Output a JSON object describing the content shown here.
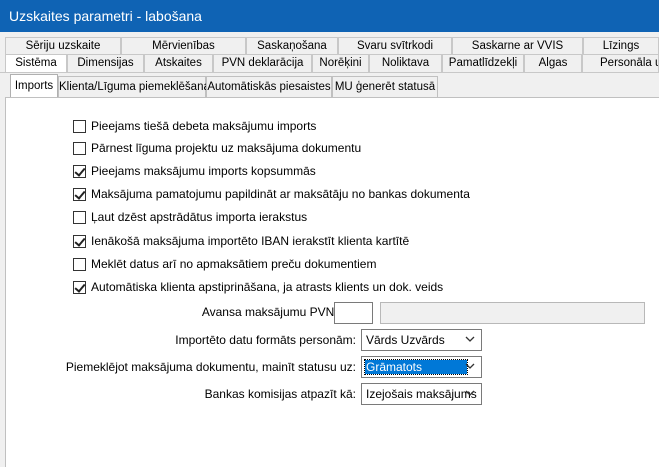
{
  "window": {
    "title": "Uzskaites parametri - labošana"
  },
  "tabs_row1": [
    "Sēriju uzskaite",
    "Mērvienības",
    "Saskaņošana",
    "Svaru svītrkodi",
    "Saskarne ar VVIS",
    "Līzings"
  ],
  "tabs_row2": [
    "Sistēma",
    "Dimensijas",
    "Atskaites",
    "PVN deklarācija",
    "Norēķini",
    "Noliktava",
    "Pamatlīdzekļi",
    "Algas",
    "Personāla uz"
  ],
  "active_tab_row2": "Sistēma",
  "subtabs": [
    "Imports",
    "Klienta/Līguma piemeklēšana",
    "Automātiskās piesaistes",
    "MU ģenerēt statusā"
  ],
  "active_subtab": "Imports",
  "checkboxes": [
    {
      "label": "Pieejams tiešā debeta maksājumu imports",
      "checked": false
    },
    {
      "label": "Pārnest līguma projektu uz maksājuma dokumentu",
      "checked": false
    },
    {
      "label": "Pieejams maksājumu imports kopsummās",
      "checked": true
    },
    {
      "label": "Maksājuma pamatojumu papildināt ar maksātāju no bankas dokumenta",
      "checked": true
    },
    {
      "label": "Ļaut dzēst apstrādātus importa ierakstus",
      "checked": false
    },
    {
      "label": "Ienākošā maksājuma importēto IBAN ierakstīt klienta kartītē",
      "checked": true
    },
    {
      "label": "Meklēt datus arī no apmaksātiem preču dokumentiem",
      "checked": false
    },
    {
      "label": "Automātiska klienta apstiprināšana, ja atrasts klients un dok. veids",
      "checked": true
    }
  ],
  "fields": {
    "avansa_label": "Avansa maksājumu PVN likme:",
    "avansa_value": "",
    "avansa_desc": "",
    "format_label": "Importēto datu formāts personām:",
    "format_value": "Vārds Uzvārds",
    "status_label": "Piemeklējot maksājuma dokumentu, mainīt statusu uz:",
    "status_value": "Grāmatots",
    "commission_label": "Bankas komisijas atpazīt kā:",
    "commission_value": "Izejošais maksājums"
  },
  "colors": {
    "titlebar": "#0f63b4",
    "selection": "#0078d7"
  }
}
